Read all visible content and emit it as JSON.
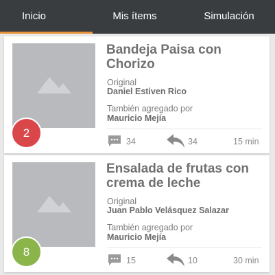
{
  "tabs": [
    {
      "label": "Inicio",
      "active": true
    },
    {
      "label": "Mis ítems",
      "active": false
    },
    {
      "label": "Simulación",
      "active": false
    }
  ],
  "colors": {
    "tabbar_bg": "#3a3d40",
    "active_indicator": "#e8933a",
    "thumbnail_placeholder": "#b8babd"
  },
  "cards": [
    {
      "title": "Bandeja Paisa con Chorizo",
      "original_label": "Original",
      "original_author": "Daniel Estiven Rico",
      "also_added_label": "También agregado por",
      "also_added_by": "Mauricio Mejía",
      "badge": "2",
      "badge_color": "#d9474b",
      "comments": "34",
      "shares": "34",
      "time": "15 min",
      "thumbnail_icon": "image-placeholder-icon"
    },
    {
      "title": "Ensalada de frutas con crema de leche",
      "original_label": "Original",
      "original_author": "Juan Pablo Velásquez Salazar",
      "also_added_label": "También agregado por",
      "also_added_by": "Mauricio Mejía",
      "badge": "8",
      "badge_color": "#8bb44a",
      "comments": "15",
      "shares": "10",
      "time": "30 min",
      "thumbnail_icon": "image-placeholder-icon"
    }
  ]
}
